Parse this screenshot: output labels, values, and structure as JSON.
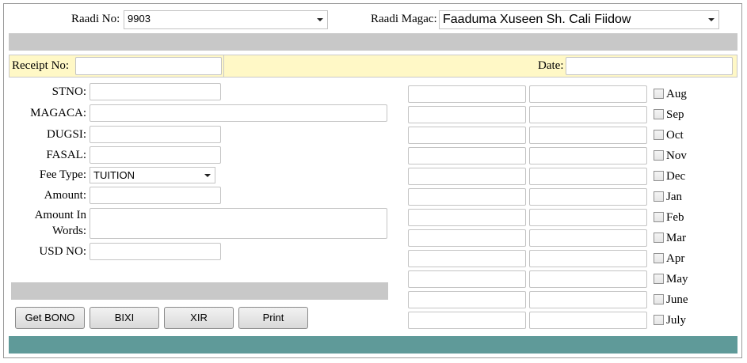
{
  "header": {
    "raadi_no_label": "Raadi No:",
    "raadi_no_value": "9903",
    "raadi_magac_label": "Raadi Magac:",
    "raadi_magac_value": "Faaduma Xuseen Sh. Cali Fiidow"
  },
  "receipt": {
    "receipt_no_label": "Receipt No:",
    "receipt_no_value": "",
    "date_label": "Date:",
    "date_value": ""
  },
  "form": {
    "stno_label": "STNO:",
    "magaca_label": "MAGACA:",
    "dugsi_label": "DUGSI:",
    "fasal_label": "FASAL:",
    "fee_type_label": "Fee Type:",
    "fee_type_value": "TUITION",
    "amount_label": "Amount:",
    "amount_words_label_1": "Amount In",
    "amount_words_label_2": "Words:",
    "usd_no_label": "USD NO:"
  },
  "buttons": {
    "get_bono": "Get BONO",
    "bixi": "BIXI",
    "xir": "XIR",
    "print": "Print"
  },
  "months": [
    {
      "label": "Aug",
      "checked": false
    },
    {
      "label": "Sep",
      "checked": false
    },
    {
      "label": "Oct",
      "checked": false
    },
    {
      "label": "Nov",
      "checked": false
    },
    {
      "label": "Dec",
      "checked": false
    },
    {
      "label": "Jan",
      "checked": false
    },
    {
      "label": "Feb",
      "checked": false
    },
    {
      "label": "Mar",
      "checked": false
    },
    {
      "label": "Apr",
      "checked": false
    },
    {
      "label": "May",
      "checked": false
    },
    {
      "label": "June",
      "checked": false
    },
    {
      "label": "July",
      "checked": false
    }
  ],
  "colors": {
    "gray_bar": "#c8c8c8",
    "yellow_bar": "#fff8c6",
    "footer_bar": "#5f9a99"
  }
}
